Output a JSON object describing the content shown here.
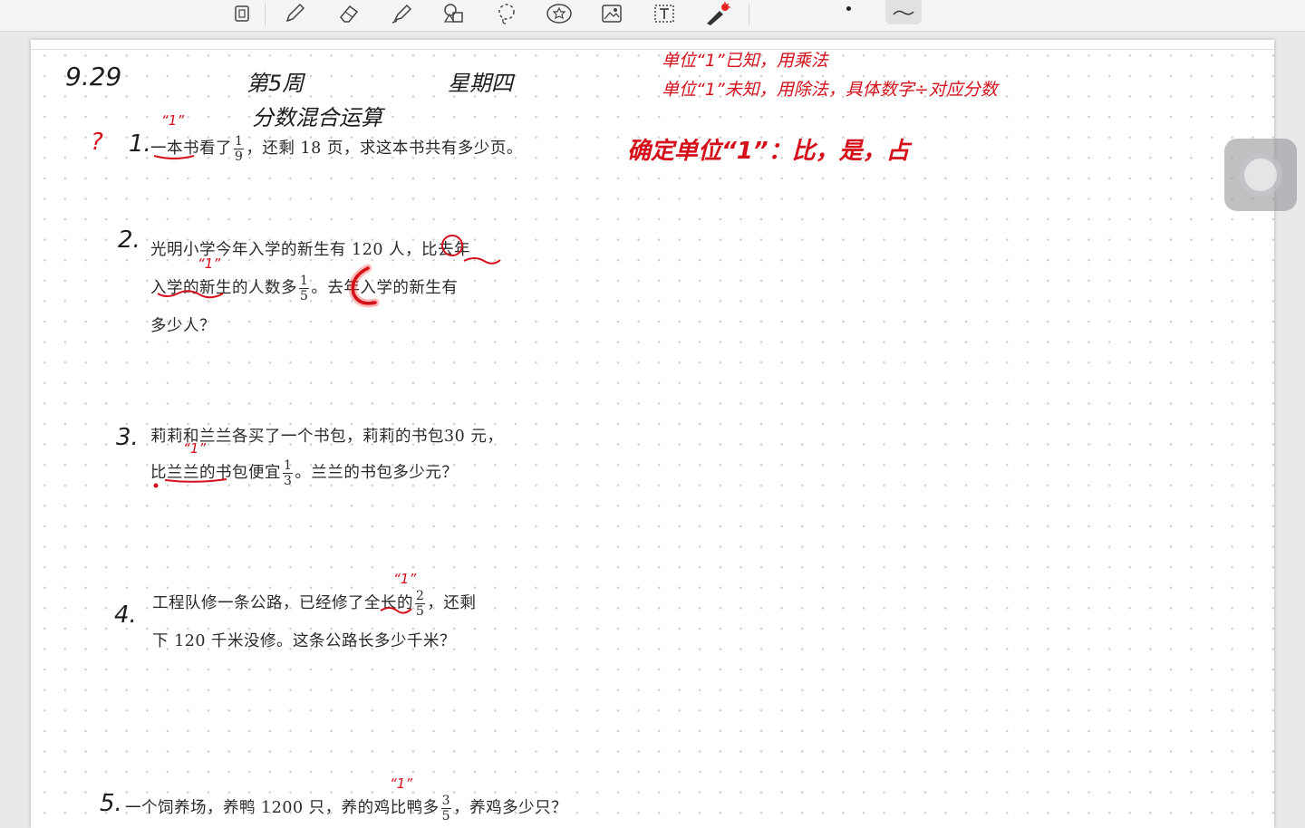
{
  "toolbar": {
    "tools": [
      {
        "icon": "lasso-select-icon"
      },
      {
        "icon": "pen-icon"
      },
      {
        "icon": "eraser-icon"
      },
      {
        "icon": "highlighter-icon"
      },
      {
        "icon": "shapes-icon"
      },
      {
        "icon": "lasso-icon"
      },
      {
        "icon": "sticker-icon"
      },
      {
        "icon": "image-icon"
      },
      {
        "icon": "text-box-icon"
      },
      {
        "icon": "laser-pointer-icon"
      }
    ],
    "active_color": "#d4101b"
  },
  "header": {
    "date": "9.29",
    "week": "第5周",
    "weekday": "星期四",
    "topic": "分数混合运算"
  },
  "notes": {
    "line1": "单位“1”已知，用乘法",
    "line2": "单位“1”未知，用除法，具体数字÷对应分数",
    "key_point": "确定单位“1”：比，是，占"
  },
  "marks": {
    "unit_one": "“1”",
    "question_mark": "?"
  },
  "questions": [
    {
      "number": "1.",
      "lines": [
        {
          "before": "一本书看了",
          "frac_num": "1",
          "frac_den": "9",
          "after": "，还剩 18 页，求这本书共有多少页。"
        }
      ]
    },
    {
      "number": "2.",
      "lines": [
        {
          "text": "光明小学今年入学的新生有 120 人，比去年"
        },
        {
          "before": "入学的新生的人数多",
          "frac_num": "1",
          "frac_den": "5",
          "after": "。去年入学的新生有"
        },
        {
          "text": "多少人？"
        }
      ]
    },
    {
      "number": "3.",
      "lines": [
        {
          "text": "莉莉和兰兰各买了一个书包，莉莉的书包30 元，"
        },
        {
          "before": "比兰兰的书包便宜",
          "frac_num": "1",
          "frac_den": "3",
          "after": "。兰兰的书包多少元？"
        }
      ]
    },
    {
      "number": "4.",
      "lines": [
        {
          "before": "工程队修一条公路，已经修了全长的",
          "frac_num": "2",
          "frac_den": "5",
          "after": "，还剩"
        },
        {
          "text": "下 120 千米没修。这条公路长多少千米？"
        }
      ]
    },
    {
      "number": "5.",
      "lines": [
        {
          "before": "一个饲养场，养鸭 1200 只，养的鸡比鸭多",
          "frac_num": "3",
          "frac_den": "5",
          "after": "，养鸡多少只？"
        }
      ]
    }
  ]
}
